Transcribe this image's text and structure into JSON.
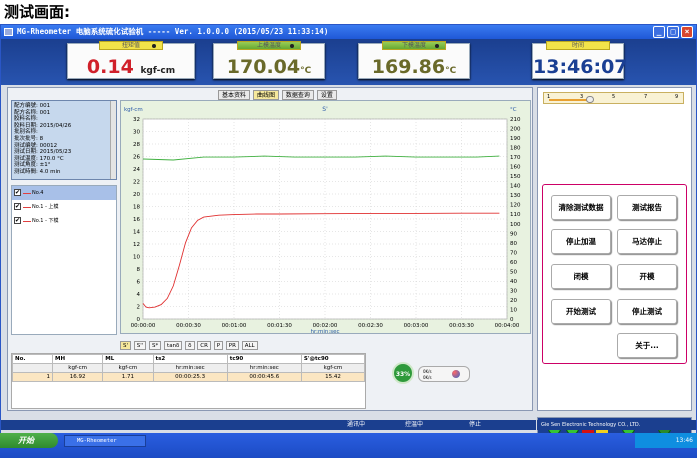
{
  "caption": "测试画面:",
  "window": {
    "title": "MG-Rheometer 电脑系统硫化试验机 ----- Ver. 1.0.0.0 (2015/05/23 11:33:14)",
    "minimize": "_",
    "maximize": "□",
    "close": "×"
  },
  "gauges": [
    {
      "label": "扭矩值",
      "value": "0.14",
      "unit": "kgf-cm",
      "color": "#d0202a"
    },
    {
      "label": "上模温度",
      "value": "170.04",
      "unit": "°C",
      "color": "#6a6a2a"
    },
    {
      "label": "下模温度",
      "value": "169.86",
      "unit": "°C",
      "color": "#6a6a2a"
    },
    {
      "label": "时间",
      "value": "13:46:07",
      "unit": "",
      "color": "#1a3f93"
    }
  ],
  "tabs": [
    "基本资料",
    "曲线图",
    "数据查询",
    "设置"
  ],
  "info": [
    "配方编號: 001",
    "配方名称: 001",
    "胶料名称:",
    "胶料日期: 2015/04/26",
    "批别名称:",
    "批次批号: 8",
    "测试编號: 00012",
    "测试日期: 2015/05/23",
    "测试温度: 170.0 °C",
    "测试角度: ±1°",
    "测试時間: 4.0 min"
  ],
  "legend": [
    {
      "label": "No.4",
      "color": "#e04040",
      "checked": "✔"
    },
    {
      "label": "No.1 - 上模",
      "color": "#e04040",
      "checked": "✔"
    },
    {
      "label": "No.1 - 下模",
      "color": "#e04040",
      "checked": "✔"
    }
  ],
  "chart_data": {
    "type": "line",
    "title": "S'",
    "ylabel_left": "kgf-cm",
    "ylabel_right": "°C",
    "xlabel": "hr:min:sec",
    "x_ticks": [
      "00:00:00",
      "00:00:30",
      "00:01:00",
      "00:01:30",
      "00:02:00",
      "00:02:30",
      "00:03:00",
      "00:03:30",
      "00:04:00"
    ],
    "y_left_ticks": [
      "0",
      "2",
      "4",
      "6",
      "8",
      "10",
      "12",
      "14",
      "16",
      "18",
      "20",
      "22",
      "24",
      "26",
      "28",
      "30",
      "32"
    ],
    "y_right_ticks": [
      "0",
      "10",
      "20",
      "30",
      "40",
      "50",
      "60",
      "70",
      "80",
      "90",
      "100",
      "110",
      "120",
      "130",
      "140",
      "150",
      "160",
      "170",
      "180",
      "190",
      "200",
      "210"
    ],
    "ylim_left": [
      0,
      32
    ],
    "ylim_right": [
      0,
      210
    ],
    "xlim_sec": [
      0,
      240
    ],
    "series": [
      {
        "name": "S'",
        "axis": "left",
        "color": "#e03030",
        "x": [
          0,
          2,
          4,
          8,
          12,
          16,
          20,
          24,
          28,
          32,
          36,
          40,
          50,
          60,
          75,
          90,
          120,
          150,
          180,
          210,
          235
        ],
        "y": [
          2.5,
          1.9,
          1.8,
          1.9,
          2.3,
          3.3,
          5.3,
          8.6,
          12.2,
          14.6,
          15.8,
          16.3,
          16.6,
          16.7,
          16.8,
          16.8,
          16.85,
          16.9,
          16.9,
          16.92,
          16.92
        ]
      },
      {
        "name": "温度",
        "axis": "right",
        "color": "#40b040",
        "x": [
          0,
          20,
          40,
          60,
          80,
          100,
          120,
          140,
          160,
          180,
          200,
          220,
          235
        ],
        "y": [
          168,
          167,
          170,
          170,
          171,
          170,
          170,
          170,
          171,
          170,
          170,
          170,
          171
        ]
      }
    ]
  },
  "chips": [
    "S'",
    "S''",
    "S*",
    "tanδ",
    "δ",
    "CR",
    "P",
    "PR",
    "ALL"
  ],
  "table": {
    "header1": [
      "No.",
      "MH",
      "ML",
      "ts2",
      "tc90",
      "S'@tc90"
    ],
    "header2": [
      "",
      "kgf-cm",
      "kgf-cm",
      "hr:min:sec",
      "hr:min:sec",
      "kgf-cm"
    ],
    "rows": [
      [
        "1",
        "16.92",
        "1.71",
        "00:00:25.3",
        "00:00:45.6",
        "15.42"
      ]
    ]
  },
  "progress": {
    "pct": "33%",
    "speed1": "0K/s",
    "speed2": "0K/s"
  },
  "slider": {
    "ticks": [
      "1",
      "3",
      "5",
      "7",
      "9"
    ]
  },
  "buttons": [
    "清除测试数据",
    "测试报告",
    "停止加温",
    "马达停止",
    "闭模",
    "开模",
    "开始测试",
    "停止测试",
    "关于..."
  ],
  "lamps": {
    "al": "AL",
    "at": "AT"
  },
  "statusbar": [
    "通讯中",
    "控温中",
    "停止",
    "Gie Sen Electronic Technology CO., LTD."
  ],
  "taskbar": {
    "start": "开始",
    "task": "MG-Rheometer",
    "clock": "13:46"
  }
}
